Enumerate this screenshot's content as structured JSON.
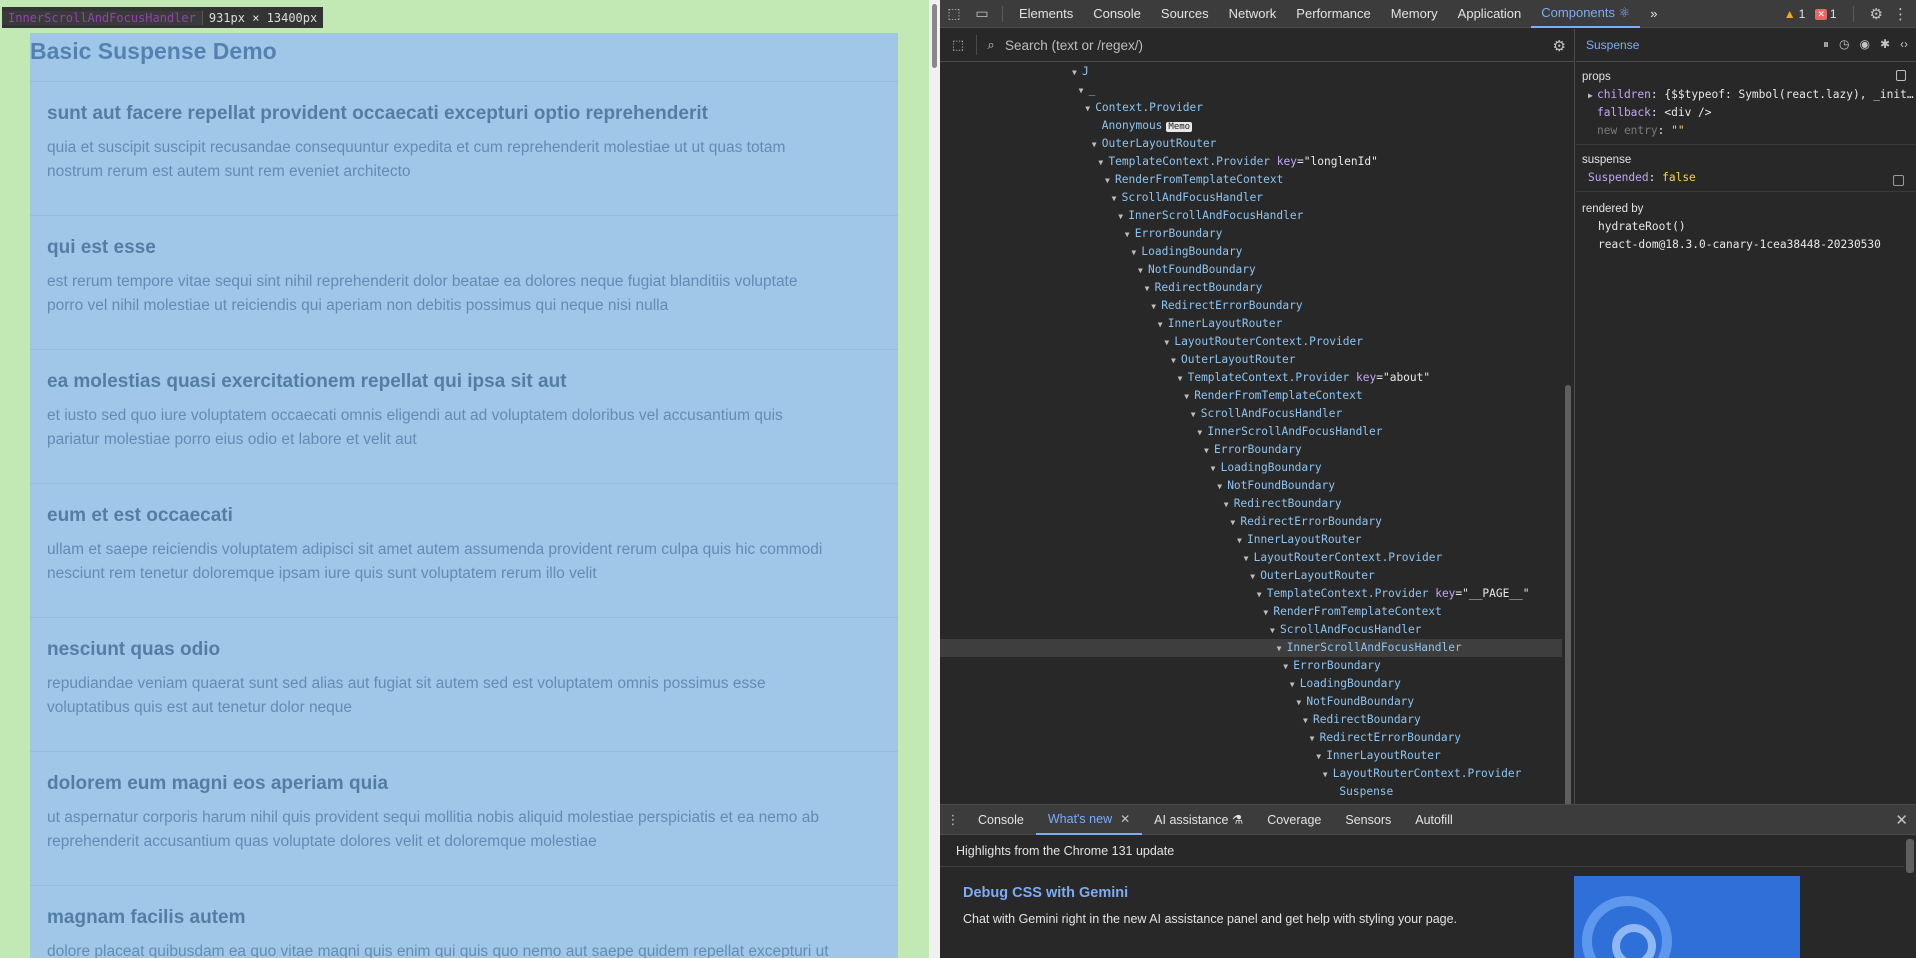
{
  "page": {
    "title": "Basic Suspense Demo",
    "posts": [
      {
        "title": "sunt aut facere repellat provident occaecati excepturi optio reprehenderit",
        "body_l1": "quia et suscipit suscipit recusandae consequuntur expedita et cum reprehenderit molestiae ut ut quas totam",
        "body_l2": "nostrum rerum est autem sunt rem eveniet architecto"
      },
      {
        "title": "qui est esse",
        "body_l1": "est rerum tempore vitae sequi sint nihil reprehenderit dolor beatae ea dolores neque fugiat blanditiis voluptate",
        "body_l2": "porro vel nihil molestiae ut reiciendis qui aperiam non debitis possimus qui neque nisi nulla"
      },
      {
        "title": "ea molestias quasi exercitationem repellat qui ipsa sit aut",
        "body_l1": "et iusto sed quo iure voluptatem occaecati omnis eligendi aut ad voluptatem doloribus vel accusantium quis",
        "body_l2": "pariatur molestiae porro eius odio et labore et velit aut"
      },
      {
        "title": "eum et est occaecati",
        "body_l1": "ullam et saepe reiciendis voluptatem adipisci sit amet autem assumenda provident rerum culpa quis hic commodi",
        "body_l2": "nesciunt rem tenetur doloremque ipsam iure quis sunt voluptatem rerum illo velit"
      },
      {
        "title": "nesciunt quas odio",
        "body_l1": "repudiandae veniam quaerat sunt sed alias aut fugiat sit autem sed est voluptatem omnis possimus esse",
        "body_l2": "voluptatibus quis est aut tenetur dolor neque"
      },
      {
        "title": "dolorem eum magni eos aperiam quia",
        "body_l1": "ut aspernatur corporis harum nihil quis provident sequi mollitia nobis aliquid molestiae perspiciatis et ea nemo ab",
        "body_l2": "reprehenderit accusantium quas voluptate dolores velit et doloremque molestiae"
      },
      {
        "title": "magnam facilis autem",
        "body_l1": "dolore placeat quibusdam ea quo vitae magni quis enim qui quis quo nemo aut saepe quidem repellat excepturi ut",
        "body_l2": ""
      }
    ],
    "tooltip": {
      "name": "InnerScrollAndFocusHandler",
      "size": "931px × 13400px"
    }
  },
  "devtools": {
    "tabs": [
      "Elements",
      "Console",
      "Sources",
      "Network",
      "Performance",
      "Memory",
      "Application",
      "Components ⚛"
    ],
    "more": "»",
    "warnings": "1",
    "errors": "1",
    "search_placeholder": "Search (text or /regex/)",
    "tree": [
      {
        "d": 0,
        "name": "J"
      },
      {
        "d": 1,
        "name": "_"
      },
      {
        "d": 2,
        "name": "Context.Provider"
      },
      {
        "d": 3,
        "name": "Anonymous",
        "memo": "Memo",
        "noarrow": true
      },
      {
        "d": 3,
        "name": "OuterLayoutRouter"
      },
      {
        "d": 4,
        "name": "TemplateContext.Provider",
        "key": "longlenId"
      },
      {
        "d": 5,
        "name": "RenderFromTemplateContext"
      },
      {
        "d": 6,
        "name": "ScrollAndFocusHandler"
      },
      {
        "d": 7,
        "name": "InnerScrollAndFocusHandler"
      },
      {
        "d": 8,
        "name": "ErrorBoundary"
      },
      {
        "d": 9,
        "name": "LoadingBoundary"
      },
      {
        "d": 10,
        "name": "NotFoundBoundary"
      },
      {
        "d": 11,
        "name": "RedirectBoundary"
      },
      {
        "d": 12,
        "name": "RedirectErrorBoundary"
      },
      {
        "d": 13,
        "name": "InnerLayoutRouter"
      },
      {
        "d": 14,
        "name": "LayoutRouterContext.Provider"
      },
      {
        "d": 15,
        "name": "OuterLayoutRouter"
      },
      {
        "d": 16,
        "name": "TemplateContext.Provider",
        "key": "about"
      },
      {
        "d": 17,
        "name": "RenderFromTemplateContext"
      },
      {
        "d": 18,
        "name": "ScrollAndFocusHandler"
      },
      {
        "d": 19,
        "name": "InnerScrollAndFocusHandler"
      },
      {
        "d": 20,
        "name": "ErrorBoundary"
      },
      {
        "d": 21,
        "name": "LoadingBoundary"
      },
      {
        "d": 22,
        "name": "NotFoundBoundary"
      },
      {
        "d": 23,
        "name": "RedirectBoundary"
      },
      {
        "d": 24,
        "name": "RedirectErrorBoundary"
      },
      {
        "d": 25,
        "name": "InnerLayoutRouter"
      },
      {
        "d": 26,
        "name": "LayoutRouterContext.Provider"
      },
      {
        "d": 27,
        "name": "OuterLayoutRouter"
      },
      {
        "d": 28,
        "name": "TemplateContext.Provider",
        "key": "__PAGE__"
      },
      {
        "d": 29,
        "name": "RenderFromTemplateContext"
      },
      {
        "d": 30,
        "name": "ScrollAndFocusHandler"
      },
      {
        "d": 31,
        "name": "InnerScrollAndFocusHandler",
        "hover": true
      },
      {
        "d": 32,
        "name": "ErrorBoundary"
      },
      {
        "d": 33,
        "name": "LoadingBoundary"
      },
      {
        "d": 34,
        "name": "NotFoundBoundary"
      },
      {
        "d": 35,
        "name": "RedirectBoundary"
      },
      {
        "d": 36,
        "name": "RedirectErrorBoundary"
      },
      {
        "d": 37,
        "name": "InnerLayoutRouter"
      },
      {
        "d": 38,
        "name": "LayoutRouterContext.Provider"
      },
      {
        "d": 39,
        "name": "Suspense",
        "noarrow": true
      }
    ],
    "props_panel": {
      "selected": "Suspense",
      "props_title": "props",
      "props": [
        {
          "key": "children",
          "value": "{$$typeof: Symbol(react.lazy), _init…",
          "arrow": true
        },
        {
          "key": "fallback",
          "value": "<div />"
        },
        {
          "key": "new entry",
          "value": "\"\"",
          "dim": true
        }
      ],
      "suspense_title": "suspense",
      "suspended_key": "Suspended",
      "suspended_value": "false",
      "rendered_by_title": "rendered by",
      "rendered_by": [
        "hydrateRoot()",
        "react-dom@18.3.0-canary-1cea38448-20230530"
      ]
    },
    "drawer": {
      "tabs": [
        "Console",
        "What's new",
        "AI assistance ⚗",
        "Coverage",
        "Sensors",
        "Autofill"
      ],
      "highlights": "Highlights from the Chrome 131 update",
      "feature_title": "Debug CSS with Gemini",
      "feature_desc": "Chat with Gemini right in the new AI assistance panel and get help with styling your page."
    }
  }
}
